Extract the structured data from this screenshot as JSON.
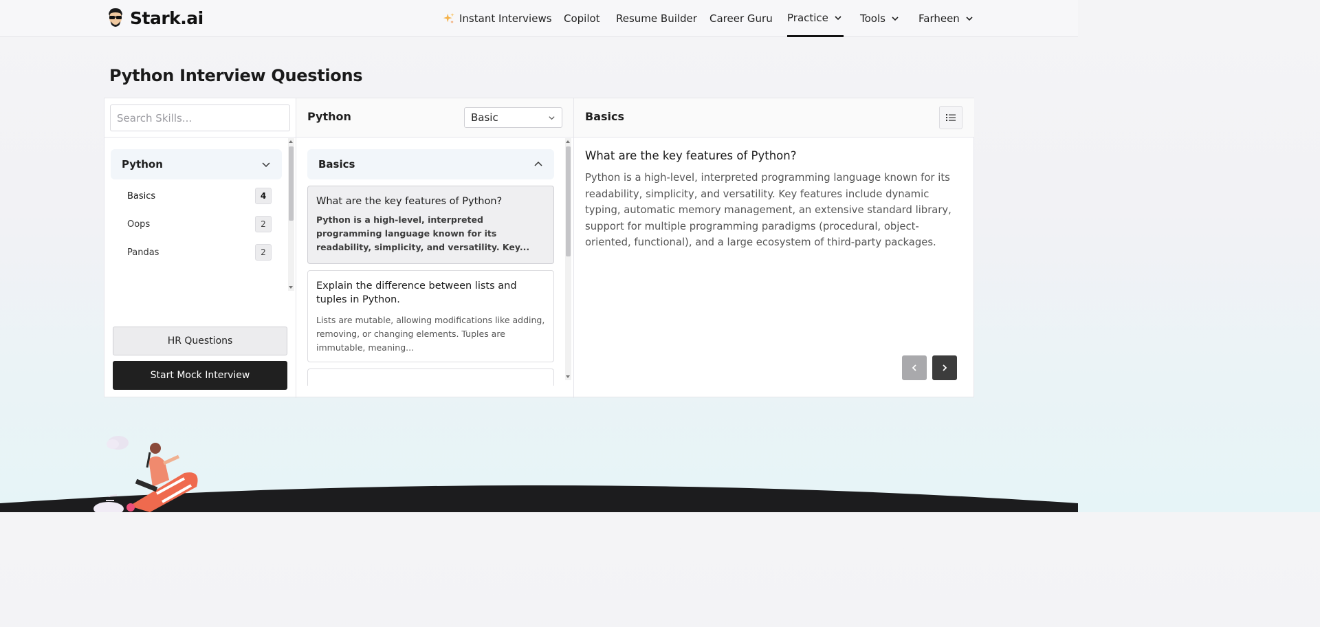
{
  "header": {
    "brand": "Stark.ai",
    "nav": {
      "instant_interviews": "Instant Interviews",
      "copilot": "Copilot",
      "resume_builder": "Resume Builder",
      "career_guru": "Career Guru",
      "practice": "Practice",
      "tools": "Tools",
      "user": "Farheen"
    },
    "active_nav": "Practice"
  },
  "page": {
    "title": "Python Interview Questions"
  },
  "left": {
    "search_placeholder": "Search Skills...",
    "group": "Python",
    "items": [
      {
        "label": "Basics",
        "count": "4"
      },
      {
        "label": "Oops",
        "count": "2"
      },
      {
        "label": "Pandas",
        "count": "2"
      }
    ],
    "hr_button": "HR Questions",
    "mock_button": "Start Mock Interview"
  },
  "middle": {
    "skill": "Python",
    "level": "Basic",
    "section": "Basics",
    "questions": [
      {
        "title": "What are the key features of Python?",
        "preview": "Python is a high-level, interpreted programming language known for its readability, simplicity, and versatility. Key..."
      },
      {
        "title": "Explain the difference between lists and tuples in Python.",
        "preview": "Lists are mutable, allowing modifications like adding, removing, or changing elements. Tuples are immutable, meaning..."
      }
    ]
  },
  "right": {
    "section": "Basics",
    "question": "What are the key features of Python?",
    "answer": "Python is a high-level, interpreted programming language known for its readability, simplicity, and versatility. Key features include dynamic typing, automatic memory management, an extensive standard library, support for multiple programming paradigms (procedural, object-oriented, functional), and a large ecosystem of third-party packages."
  },
  "colors": {
    "primary_dark": "#202020",
    "accent_soft": "#f2f6fa",
    "text_muted": "#555555"
  }
}
